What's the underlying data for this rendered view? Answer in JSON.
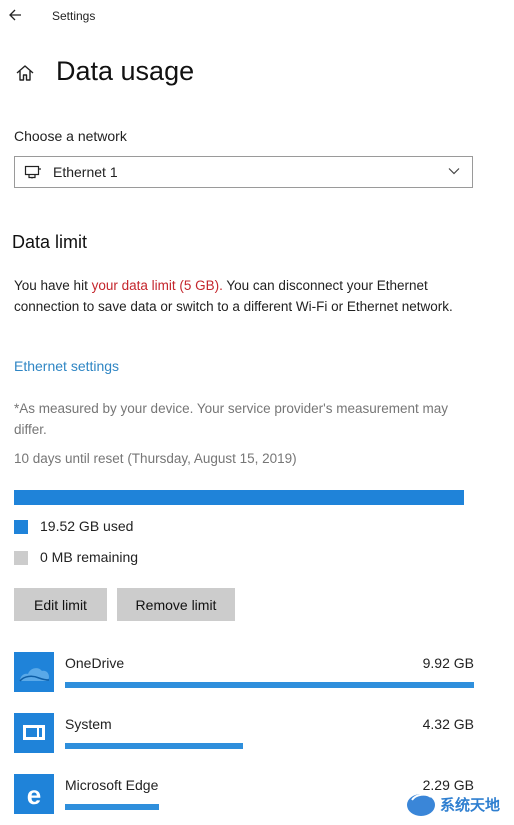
{
  "window": {
    "title": "Settings"
  },
  "page": {
    "title": "Data usage"
  },
  "network": {
    "label": "Choose a network",
    "selected": "Ethernet 1"
  },
  "data_limit": {
    "heading": "Data limit",
    "message_part1": "You have hit ",
    "message_highlight": "your data limit (5 GB).",
    "message_part2": " You can disconnect your Ethernet connection to save data or switch to a different Wi-Fi or Ethernet network.",
    "settings_link": "Ethernet settings",
    "note": "*As measured by your device. Your service provider's measurement may differ.",
    "reset_text": "10 days until reset (Thursday, August 15, 2019)",
    "usage_fraction": 1.0,
    "used_label": "19.52 GB used",
    "remaining_label": "0 MB remaining",
    "used_color": "#1f83d9",
    "remaining_color": "#cccccc",
    "edit_button": "Edit limit",
    "remove_button": "Remove limit"
  },
  "apps": [
    {
      "name": "OneDrive",
      "size": "9.92 GB",
      "icon": "onedrive-icon",
      "fraction": 1.0
    },
    {
      "name": "System",
      "size": "4.32 GB",
      "icon": "system-icon",
      "fraction": 0.435
    },
    {
      "name": "Microsoft Edge",
      "size": "2.29 GB",
      "icon": "edge-icon",
      "fraction": 0.231
    }
  ],
  "watermark": {
    "text": "系统天地"
  }
}
